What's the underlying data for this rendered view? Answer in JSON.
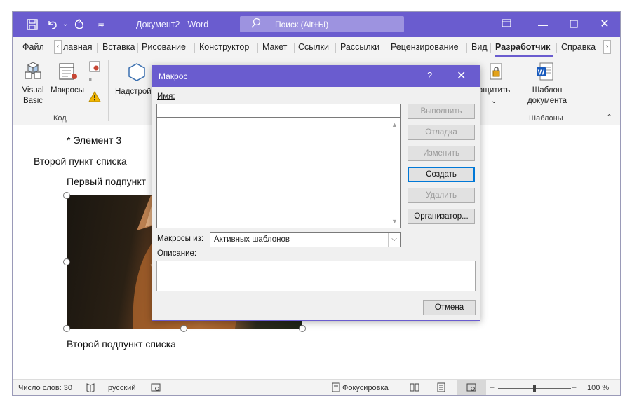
{
  "window": {
    "doc_title": "Документ2 - Word",
    "search_placeholder": "Поиск (Alt+Ы)"
  },
  "tabs": [
    {
      "label": "Файл"
    },
    {
      "label": "лавная"
    },
    {
      "label": "Вставка"
    },
    {
      "label": "Рисование"
    },
    {
      "label": "Конструктор"
    },
    {
      "label": "Макет"
    },
    {
      "label": "Ссылки"
    },
    {
      "label": "Рассылки"
    },
    {
      "label": "Рецензирование"
    },
    {
      "label": "Вид"
    },
    {
      "label": "Разработчик",
      "active": true
    },
    {
      "label": "Справка"
    }
  ],
  "ribbon": {
    "visual_basic_line1": "Visual",
    "visual_basic_line2": "Basic",
    "macros": "Макросы",
    "addins_partial": "Надстрой",
    "protect_partial": "ащитить",
    "template_line1": "Шаблон",
    "template_line2": "документа",
    "group_code": "Код",
    "group_templates": "Шаблоны"
  },
  "document": {
    "lines": [
      "* Элемент 3",
      "Второй пункт списка",
      "Первый подпункт",
      "Второй подпункт списка"
    ]
  },
  "statusbar": {
    "word_count": "Число слов: 30",
    "language": "русский",
    "focus": "Фокусировка",
    "zoom": "100 %",
    "zoom_level": 0.5
  },
  "dialog": {
    "title": "Макрос",
    "help": "?",
    "name_label": "Имя:",
    "name_value": "",
    "macros_from_label": "Макросы из:",
    "macros_from_value": "Активных шаблонов",
    "description_label": "Описание:",
    "buttons": {
      "run": "Выполнить",
      "debug": "Отладка",
      "edit": "Изменить",
      "create": "Создать",
      "delete": "Удалить",
      "organizer": "Организатор...",
      "cancel": "Отмена"
    }
  },
  "colors": {
    "accent": "#6a5ccf",
    "focus_border": "#0078d7"
  }
}
